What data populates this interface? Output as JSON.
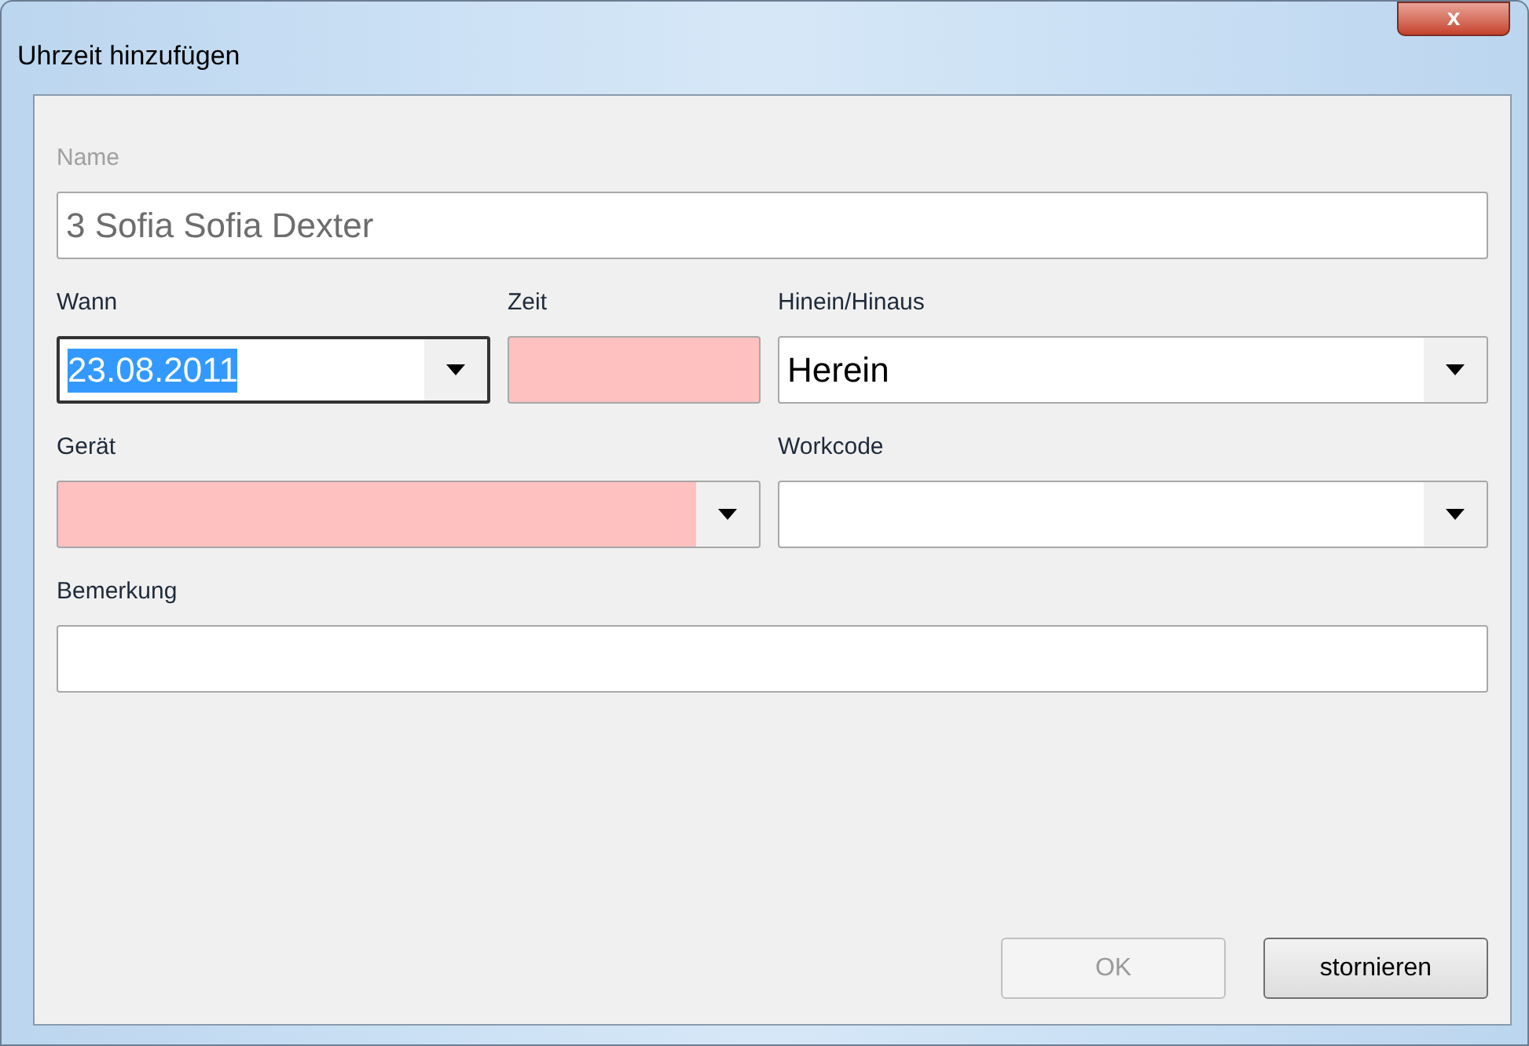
{
  "window": {
    "title": "Uhrzeit hinzufügen",
    "close_button": "x"
  },
  "form_rows": [
    [
      {
        "label": "Name",
        "kind": "text",
        "value": "3 Sofia Sofia Dexter",
        "disabled": true,
        "invalid": false,
        "text_selected": false
      }
    ],
    [
      {
        "label": "Wann",
        "kind": "combo",
        "value": "23.08.2011",
        "disabled": false,
        "invalid": false,
        "text_selected": true
      },
      {
        "label": "Zeit",
        "kind": "text",
        "disabled": false,
        "invalid": true,
        "text_selected": false
      },
      {
        "label": "Hinein/Hinaus",
        "kind": "combo",
        "value": "Herein",
        "disabled": false,
        "invalid": false,
        "text_selected": false
      }
    ],
    [
      {
        "label": "Gerät",
        "kind": "combo",
        "disabled": false,
        "invalid": true,
        "text_selected": false
      },
      {
        "label": "Workcode",
        "kind": "combo",
        "disabled": false,
        "invalid": false,
        "text_selected": false
      }
    ],
    [
      {
        "label": "Bemerkung",
        "kind": "text",
        "disabled": false,
        "invalid": false,
        "text_selected": false
      }
    ]
  ],
  "buttons": [
    {
      "label": "OK",
      "disabled": true
    },
    {
      "label": "stornieren",
      "disabled": false
    }
  ]
}
